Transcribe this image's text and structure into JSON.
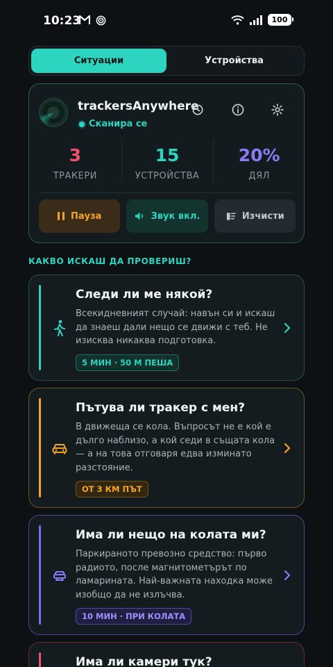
{
  "status_bar": {
    "time": "10:23",
    "battery": "100"
  },
  "tabs": [
    {
      "label": "Ситуации",
      "active": true
    },
    {
      "label": "Устройства",
      "active": false
    }
  ],
  "header": {
    "app_name": "trackersAnywhere",
    "scan_status": "Сканира се"
  },
  "stats": [
    {
      "value": "3",
      "label": "ТРАКЕРИ",
      "color": "#f0506e"
    },
    {
      "value": "15",
      "label": "УСТРОЙСТВА",
      "color": "#2dd4bf"
    },
    {
      "value": "20%",
      "label": "ДЯЛ",
      "color": "#8b7cf6"
    }
  ],
  "actions": {
    "pause": "Пауза",
    "sound": "Звук вкл.",
    "clear": "Изчисти"
  },
  "section_title": "КАКВО ИСКАШ ДА ПРОВЕРИШ?",
  "cards": [
    {
      "title": "Следи ли ме някой?",
      "desc": "Всекидневният случай: навън си и искаш да знаеш дали нещо се движи с теб. Не изисква никаква подготовка.",
      "tag": "5 МИН · 50 М ПЕША",
      "accent": "#2dd4bf"
    },
    {
      "title": "Пътува ли тракер с мен?",
      "desc": "В движеща се кола. Въпросът не е кой е дълго наблизо, а кой седи в същата кола — а на това отговаря едва изминато разстояние.",
      "tag": "ОТ 3 КМ ПЪТ",
      "accent": "#f5a524"
    },
    {
      "title": "Има ли нещо на колата ми?",
      "desc": "Паркираното превозно средство: първо радиото, после магнитометърът по ламарината. Най-важната находка може изобщо да не излъчва.",
      "tag": "10 МИН · ПРИ КОЛАТА",
      "accent": "#7b6cf0"
    },
    {
      "title": "Има ли камери тук?",
      "accent": "#f0506e"
    }
  ]
}
